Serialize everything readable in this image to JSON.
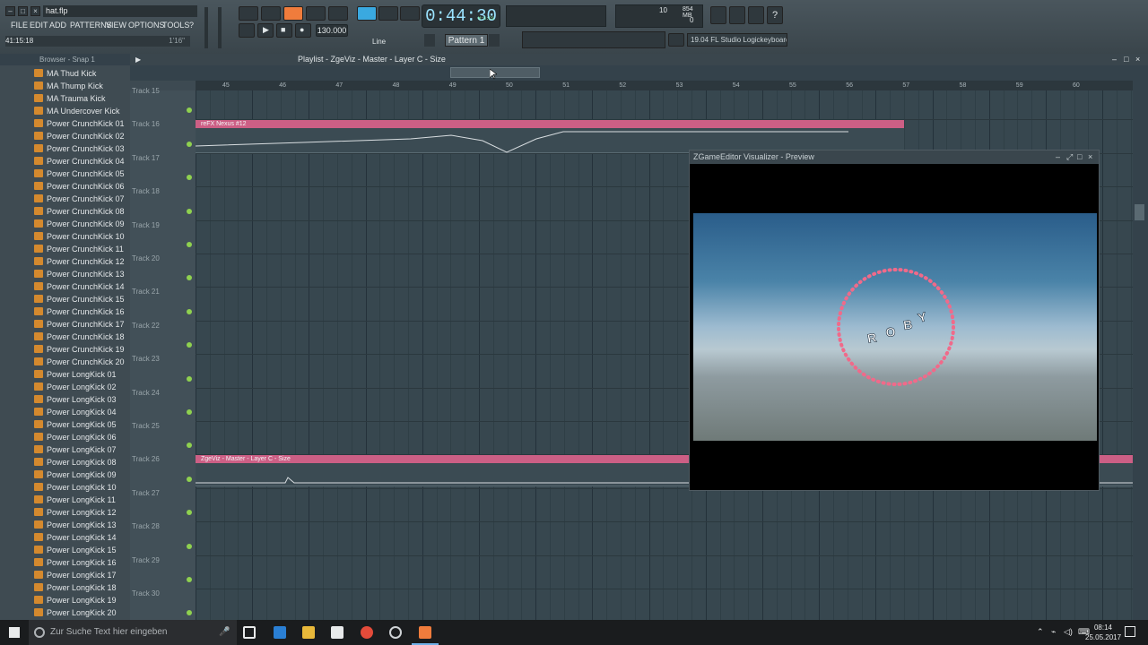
{
  "window": {
    "title": "hat.flp",
    "hint_text": "41:15:18",
    "hint_right": "1'16\""
  },
  "menu": [
    "FILE",
    "EDIT",
    "ADD",
    "PATTERNS",
    "VIEW",
    "OPTIONS",
    "TOOLS",
    "?"
  ],
  "transport": {
    "time": "0:44:30",
    "time_unit": "M:S:CS",
    "tempo": "130.000",
    "pattern": "Pattern 1",
    "snap_mode": "Line",
    "cpu": "10",
    "memory": "854 MB",
    "voices": "0"
  },
  "news": {
    "date": "19.04",
    "text": "FL Studio Logickeyboard"
  },
  "browser": {
    "header": "Browser - Snap 1",
    "items": [
      "MA Thud Kick",
      "MA Thump Kick",
      "MA Trauma Kick",
      "MA Undercover Kick",
      "Power CrunchKick 01",
      "Power CrunchKick 02",
      "Power CrunchKick 03",
      "Power CrunchKick 04",
      "Power CrunchKick 05",
      "Power CrunchKick 06",
      "Power CrunchKick 07",
      "Power CrunchKick 08",
      "Power CrunchKick 09",
      "Power CrunchKick 10",
      "Power CrunchKick 11",
      "Power CrunchKick 12",
      "Power CrunchKick 13",
      "Power CrunchKick 14",
      "Power CrunchKick 15",
      "Power CrunchKick 16",
      "Power CrunchKick 17",
      "Power CrunchKick 18",
      "Power CrunchKick 19",
      "Power CrunchKick 20",
      "Power LongKick 01",
      "Power LongKick 02",
      "Power LongKick 03",
      "Power LongKick 04",
      "Power LongKick 05",
      "Power LongKick 06",
      "Power LongKick 07",
      "Power LongKick 08",
      "Power LongKick 09",
      "Power LongKick 10",
      "Power LongKick 11",
      "Power LongKick 12",
      "Power LongKick 13",
      "Power LongKick 14",
      "Power LongKick 15",
      "Power LongKick 16",
      "Power LongKick 17",
      "Power LongKick 18",
      "Power LongKick 19",
      "Power LongKick 20"
    ]
  },
  "playlist": {
    "title": "Playlist - ZgeViz - Master - Layer C - Size",
    "ruler": [
      "45",
      "46",
      "47",
      "48",
      "49",
      "50",
      "51",
      "52",
      "53",
      "54",
      "55",
      "56",
      "57",
      "58",
      "59",
      "60"
    ],
    "tracks": [
      "Track 15",
      "Track 16",
      "Track 17",
      "Track 18",
      "Track 19",
      "Track 20",
      "Track 21",
      "Track 22",
      "Track 23",
      "Track 24",
      "Track 25",
      "Track 26",
      "Track 27",
      "Track 28",
      "Track 29",
      "Track 30"
    ],
    "clips": [
      {
        "name": "reFX Nexus #12"
      },
      {
        "name": "ZgeViz - Master - Layer C - Size"
      }
    ]
  },
  "visualizer": {
    "title": "ZGameEditor Visualizer - Preview",
    "letters": [
      "R",
      "O",
      "B",
      "Y"
    ],
    "ring_color": "#f06a8a"
  },
  "taskbar": {
    "search_placeholder": "Zur Suche Text hier eingeben",
    "time": "08:14",
    "date": "25.05.2017"
  }
}
